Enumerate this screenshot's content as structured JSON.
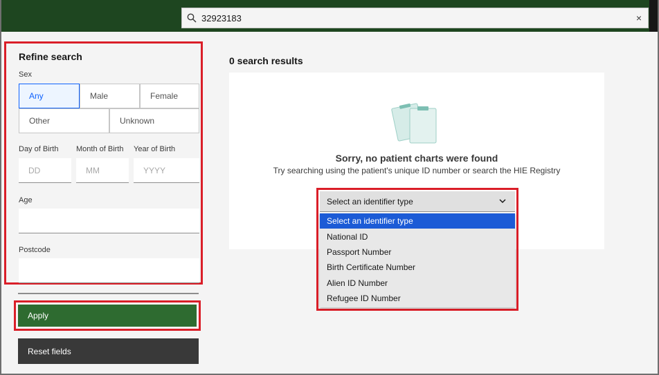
{
  "search": {
    "value": "32923183",
    "clear_label": "×"
  },
  "refine": {
    "title": "Refine search",
    "sex_label": "Sex",
    "sex_options": [
      "Any",
      "Male",
      "Female",
      "Other",
      "Unknown"
    ],
    "sex_selected": "Any",
    "dob_day_label": "Day of Birth",
    "dob_month_label": "Month of Birth",
    "dob_year_label": "Year of Birth",
    "dob_day_placeholder": "DD",
    "dob_month_placeholder": "MM",
    "dob_year_placeholder": "YYYY",
    "age_label": "Age",
    "postcode_label": "Postcode"
  },
  "buttons": {
    "apply_label": "Apply",
    "reset_label": "Reset fields"
  },
  "results": {
    "count_label": "0 search results",
    "empty_title": "Sorry, no patient charts were found",
    "empty_subtitle": "Try searching using the patient's unique ID number or search the HIE Registry"
  },
  "identifier": {
    "selected": "Select an identifier type",
    "options": [
      "Select an identifier type",
      "National ID",
      "Passport Number",
      "Birth Certificate Number",
      "Alien ID Number",
      "Refugee ID Number"
    ]
  },
  "colors": {
    "header": "#1e4620",
    "apply": "#2e6b30",
    "highlight": "#da1e28",
    "selected": "#0f62fe"
  }
}
